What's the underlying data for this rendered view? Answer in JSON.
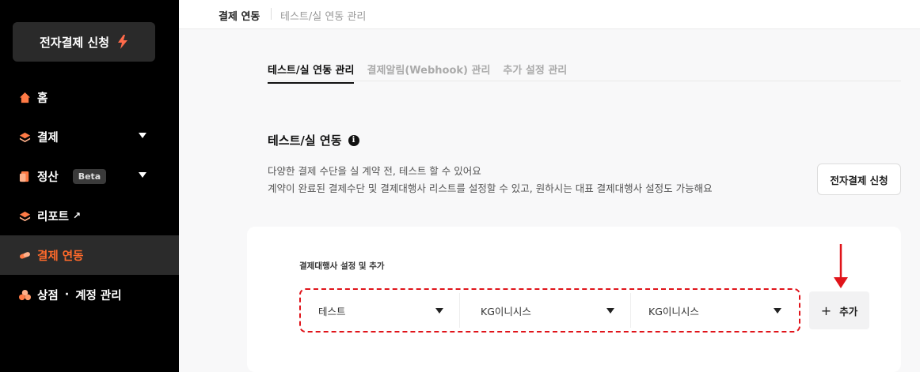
{
  "sidebar": {
    "apply_button": "전자결제 신청",
    "items": [
      {
        "label": "홈",
        "icon": "home-icon"
      },
      {
        "label": "결제",
        "icon": "layers-icon"
      },
      {
        "label": "정산",
        "icon": "document-icon",
        "badge": "Beta"
      },
      {
        "label": "리포트",
        "icon": "layers-icon",
        "ext": "↗"
      },
      {
        "label": "결제 연동",
        "icon": "link-icon"
      },
      {
        "label": "상점 · 계정 관리",
        "label_a": "상점",
        "label_sep": "·",
        "label_b": "계정 관리",
        "icon": "store-icon"
      }
    ],
    "active_color": "#ff6a2b"
  },
  "topbar": {
    "crumb_primary": "결제 연동",
    "crumb_secondary": "테스트/실 연동 관리"
  },
  "tabs": [
    {
      "label": "테스트/실 연동 관리",
      "active": true
    },
    {
      "label": "결제알림(Webhook) 관리",
      "active": false
    },
    {
      "label": "추가 설정 관리",
      "active": false
    }
  ],
  "section": {
    "title": "테스트/실 연동",
    "info_icon": "i",
    "desc_line1": "다양한 결제 수단을 실 계약 전, 테스트 할 수 있어요",
    "desc_line2": "계약이 완료된 결제수단 및 결제대행사 리스트를 설정할 수 있고, 원하시는 대표 결제대행사 설정도 가능해요",
    "apply_button": "전자결제 신청"
  },
  "card": {
    "label": "결제대행사 설정 및 추가",
    "selects": [
      {
        "value": "테스트"
      },
      {
        "value": "KG이니시스"
      },
      {
        "value": "KG이니시스"
      }
    ],
    "add_button": "추가",
    "add_icon": "+",
    "highlight_color": "#e0141a"
  }
}
